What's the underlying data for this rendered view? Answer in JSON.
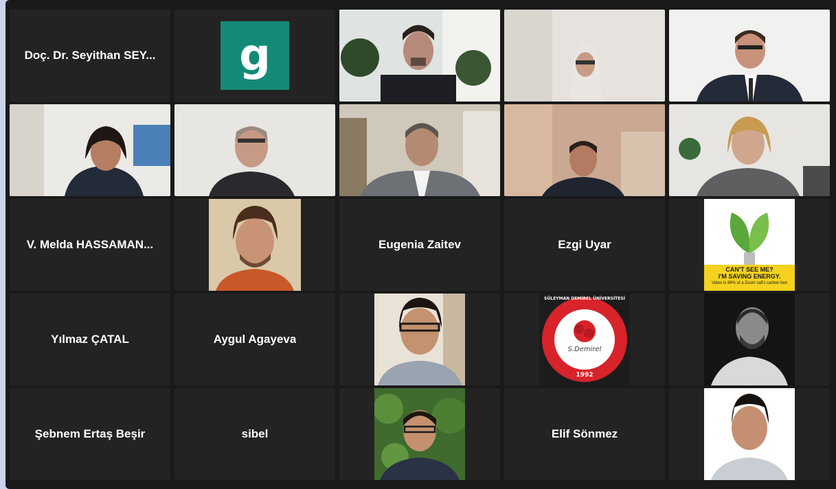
{
  "meeting": {
    "participants": [
      {
        "name": "Doç. Dr. Seyithan SEY...",
        "kind": "name"
      },
      {
        "initial": "g",
        "avatar_color": "#138a76",
        "kind": "initial"
      },
      {
        "kind": "video",
        "active_speaker": true
      },
      {
        "kind": "video"
      },
      {
        "kind": "video"
      },
      {
        "kind": "video"
      },
      {
        "kind": "video"
      },
      {
        "kind": "video"
      },
      {
        "kind": "video"
      },
      {
        "kind": "video"
      },
      {
        "name": "V. Melda HASSAMAN...",
        "kind": "name"
      },
      {
        "kind": "photo"
      },
      {
        "name": "Eugenia Zaitev",
        "kind": "name"
      },
      {
        "name": "Ezgi Uyar",
        "kind": "name"
      },
      {
        "kind": "photo",
        "poster_line1": "CAN'T SEE ME?",
        "poster_line2": "I'M SAVING ENERGY.",
        "poster_line3": "Video is 99% of a Zoom call's carbon foot"
      },
      {
        "name": "Yılmaz ÇATAL",
        "kind": "name"
      },
      {
        "name": "Aygul Agayeva",
        "kind": "name"
      },
      {
        "kind": "photo"
      },
      {
        "kind": "photo",
        "logo_ring_text": "SÜLEYMAN DEMİREL ÜNİVERSİTESİ",
        "logo_signature": "S.Demirel",
        "logo_year": "1992"
      },
      {
        "kind": "photo"
      },
      {
        "name": "Şebnem Ertaş Beşir",
        "kind": "name"
      },
      {
        "name": "sibel",
        "kind": "name"
      },
      {
        "kind": "photo"
      },
      {
        "name": "Elif Sönmez",
        "kind": "name"
      },
      {
        "kind": "photo"
      }
    ]
  },
  "colors": {
    "background": "#1a1a1a",
    "tile": "#232323",
    "active_border": "#d8e37a",
    "page_margin": "#c9d3ea"
  }
}
